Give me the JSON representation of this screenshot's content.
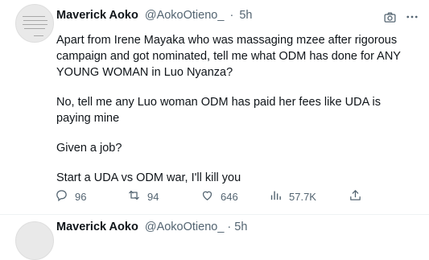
{
  "tweet": {
    "author_name": "Maverick Aoko",
    "handle": "@AokoOtieno_",
    "separator": "·",
    "time": "5h",
    "paragraphs": [
      "Apart from Irene Mayaka who was massaging mzee after rigorous campaign and got nominated, tell me what ODM has done for ANY YOUNG WOMAN in Luo Nyanza?",
      "No, tell me any Luo woman ODM has paid her fees like UDA is paying mine",
      "Given a job?",
      "Start a UDA vs ODM war, I'll kill you"
    ],
    "actions": {
      "replies": "96",
      "retweets": "94",
      "likes": "646",
      "views": "57.7K"
    }
  },
  "next_tweet": {
    "author_name": "Maverick Aoko",
    "handle": "@AokoOtieno_ · 5h"
  },
  "colors": {
    "text": "#0f1419",
    "secondary": "#536471",
    "divider": "#eff3f4"
  },
  "icons": [
    "camera-icon",
    "more-icon",
    "reply-icon",
    "retweet-icon",
    "like-icon",
    "views-icon",
    "share-icon"
  ]
}
